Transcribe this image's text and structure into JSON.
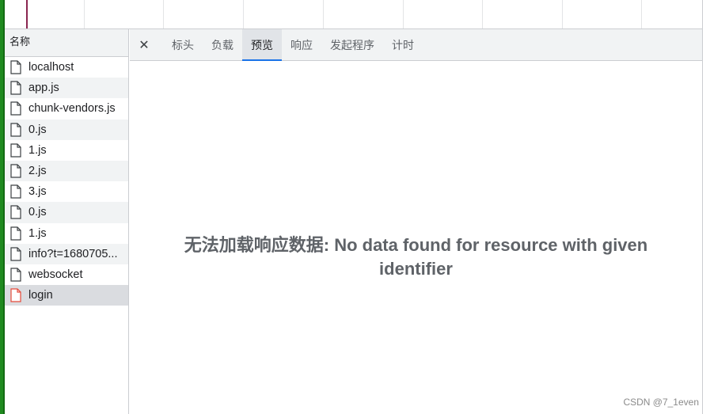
{
  "request_list": {
    "header": "名称",
    "items": [
      {
        "label": "localhost",
        "status": "ok"
      },
      {
        "label": "app.js",
        "status": "ok"
      },
      {
        "label": "chunk-vendors.js",
        "status": "ok"
      },
      {
        "label": "0.js",
        "status": "ok"
      },
      {
        "label": "1.js",
        "status": "ok"
      },
      {
        "label": "2.js",
        "status": "ok"
      },
      {
        "label": "3.js",
        "status": "ok"
      },
      {
        "label": "0.js",
        "status": "ok"
      },
      {
        "label": "1.js",
        "status": "ok"
      },
      {
        "label": "info?t=1680705...",
        "status": "ok"
      },
      {
        "label": "websocket",
        "status": "ok"
      },
      {
        "label": "login",
        "status": "error"
      }
    ],
    "selected_index": 11
  },
  "details": {
    "close_icon": "close-icon",
    "close_glyph": "✕",
    "tabs": [
      {
        "label": "标头"
      },
      {
        "label": "负载"
      },
      {
        "label": "预览"
      },
      {
        "label": "响应"
      },
      {
        "label": "发起程序"
      },
      {
        "label": "计时"
      }
    ],
    "active_tab_index": 2,
    "message": "无法加载响应数据: No data found for resource with given identifier"
  },
  "watermark": "CSDN @7_1even",
  "colors": {
    "accent": "#1a73e8",
    "error_icon": "#e5493a",
    "timeline_marker": "#8a2550",
    "left_edge": "#1f8a1f"
  }
}
